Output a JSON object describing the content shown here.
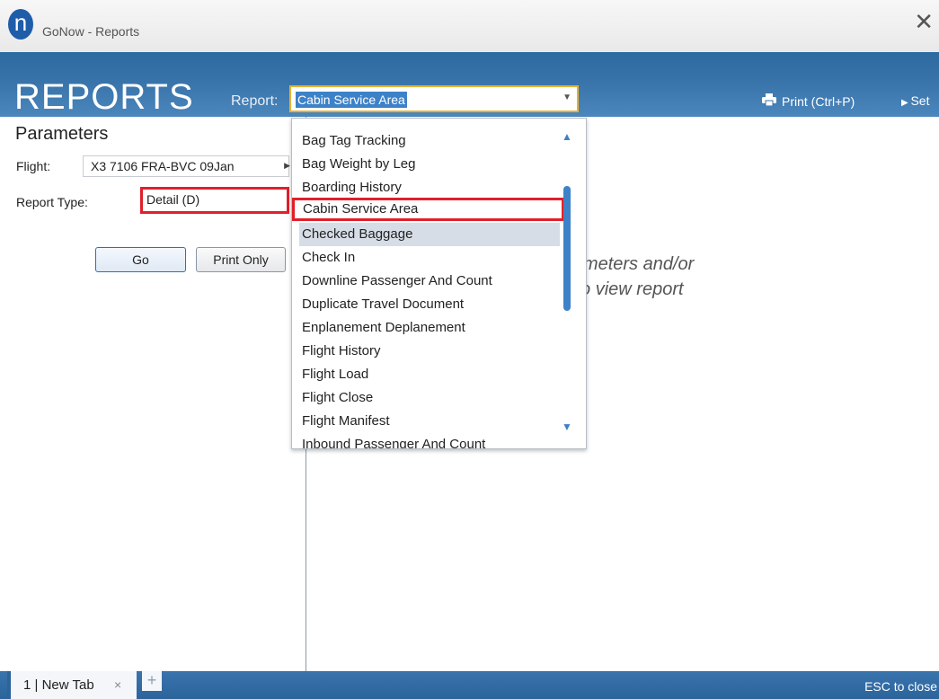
{
  "window": {
    "title": "GoNow - Reports",
    "logo_letter": "n",
    "close_glyph": "✕"
  },
  "header": {
    "title": "REPORTS",
    "report_label": "Report:",
    "report_selected": "Cabin Service Area",
    "print_label": "Print (Ctrl+P)",
    "set_label": "Set"
  },
  "parameters": {
    "title": "Parameters",
    "flight_label": "Flight:",
    "flight_value": "X3 7106 FRA-BVC 09Jan",
    "report_type_label": "Report Type:",
    "report_type_value": "Detail (D)",
    "go_label": "Go",
    "print_only_label": "Print Only"
  },
  "main": {
    "message_line1": "arameters and/or",
    "message_line2": "o' to view report"
  },
  "dropdown": {
    "items": [
      "Bag Tag Tracking",
      "Bag Weight by Leg",
      "Boarding History",
      "Cabin Service Area",
      "Checked Baggage",
      "Check In",
      "Downline Passenger And Count",
      "Duplicate Travel Document",
      "Enplanement Deplanement",
      "Flight History",
      "Flight Load",
      "Flight Close",
      "Flight Manifest",
      "Inbound Passenger And Count"
    ],
    "selected_item": "Cabin Service Area",
    "hover_item": "Checked Baggage"
  },
  "tabbar": {
    "tab_label": "1 | New Tab",
    "tab_close": "×",
    "add_tab": "+",
    "esc_hint": "ESC to close"
  },
  "colors": {
    "header_blue": "#3672a8",
    "highlight_red": "#e0202a",
    "select_border": "#e8b233",
    "accent_blue": "#3d82c8"
  }
}
